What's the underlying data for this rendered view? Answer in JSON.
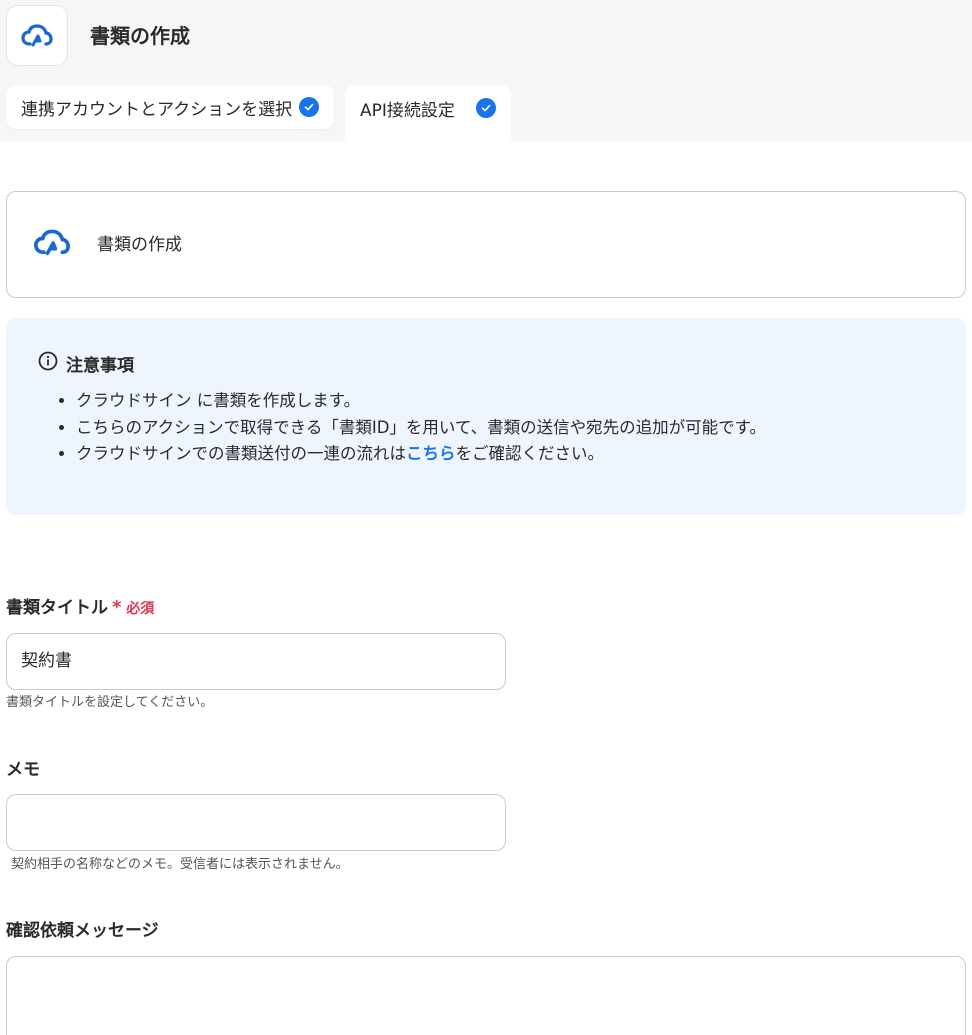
{
  "header": {
    "title": "書類の作成",
    "logo_icon": "cloudsign-cloud-icon"
  },
  "tabs": [
    {
      "label": "連携アカウントとアクションを選択",
      "completed": true
    },
    {
      "label": "API接続設定",
      "completed": true
    }
  ],
  "app_card": {
    "title": "書類の作成"
  },
  "notice": {
    "heading": "注意事項",
    "items": [
      "クラウドサイン に書類を作成します。",
      "こちらのアクションで取得できる「書類ID」を用いて、書類の送信や宛先の追加が可能です。"
    ],
    "item3_prefix": "クラウドサインでの書類送付の一連の流れは",
    "item3_link": "こちら",
    "item3_suffix": "をご確認ください。"
  },
  "fields": {
    "title": {
      "label": "書類タイトル",
      "required_mark": "*",
      "required_label": "必須",
      "value": "契約書",
      "help": "書類タイトルを設定してください。"
    },
    "memo": {
      "label": "メモ",
      "value": "",
      "help": "契約相手の名称などのメモ。受信者には表示されません。"
    },
    "message": {
      "label": "確認依頼メッセージ",
      "value": ""
    }
  },
  "colors": {
    "accent": "#1a73e8",
    "required": "#e5364b",
    "notice_bg": "#eef5fe"
  }
}
